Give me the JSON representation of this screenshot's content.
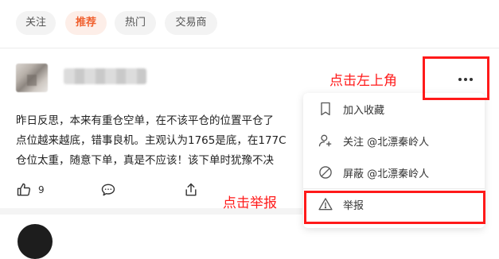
{
  "tabs": [
    {
      "label": "关注",
      "active": false
    },
    {
      "label": "推荐",
      "active": true
    },
    {
      "label": "热门",
      "active": false
    },
    {
      "label": "交易商",
      "active": false
    }
  ],
  "post": {
    "lines": [
      "昨日反思，本来有重仓空单，在不该平仓的位置平仓了",
      "点位越来越底，错事良机。主观认为1765是底，在177C",
      "仓位太重，随意下单，真是不应该！该下单时犹豫不决"
    ],
    "like_count": "9"
  },
  "menu": {
    "items": [
      {
        "label": "加入收藏",
        "icon": "bookmark-icon"
      },
      {
        "label": "关注 @北漂秦岭人",
        "icon": "user-plus-icon"
      },
      {
        "label": "屏蔽 @北漂秦岭人",
        "icon": "block-icon"
      },
      {
        "label": "举报",
        "icon": "warning-icon"
      }
    ]
  },
  "annotations": {
    "more_note": "点击左上角",
    "report_note": "点击举报",
    "color": "#ff1a1a"
  },
  "colors": {
    "accent": "#f0602e",
    "accent_bg": "#fdeee8"
  }
}
